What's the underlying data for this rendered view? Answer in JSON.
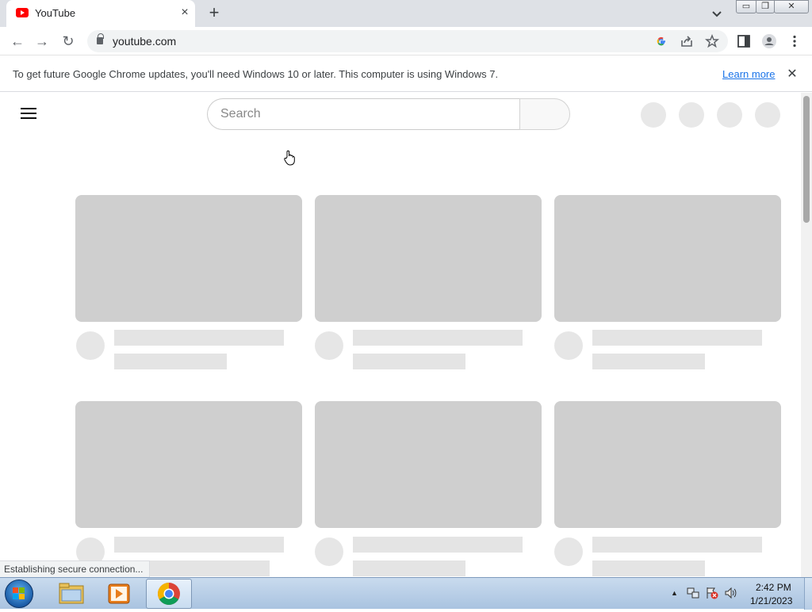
{
  "browser": {
    "tab": {
      "title": "YouTube",
      "close_glyph": "×"
    },
    "new_tab_glyph": "+",
    "window_controls": {
      "minimize": "▭",
      "maximize": "❐",
      "close": "✕"
    },
    "address": {
      "url": "youtube.com"
    },
    "nav": {
      "back": "←",
      "forward": "→",
      "reload": "↻"
    },
    "infobar": {
      "message": "To get future Google Chrome updates, you'll need Windows 10 or later. This computer is using Windows 7.",
      "link": "Learn more",
      "close_glyph": "✕"
    },
    "status_text": "Establishing secure connection..."
  },
  "youtube": {
    "search": {
      "placeholder": "Search"
    }
  },
  "taskbar": {
    "clock": {
      "time": "2:42 PM",
      "date": "1/21/2023"
    },
    "tray_up_glyph": "▲"
  },
  "colors": {
    "accent": "#1a73e8",
    "youtube_red": "#ff0000",
    "skeleton_thumb": "#cfcfcf",
    "skeleton_text": "#e4e4e4"
  },
  "icons": {
    "tab_favicon": "youtube-icon",
    "omnibox": [
      "google-icon",
      "share-icon",
      "star-icon"
    ],
    "toolbar": [
      "side-panel-icon",
      "profile-icon",
      "menu-dots-icon"
    ],
    "taskbar_apps": [
      "explorer-icon",
      "media-player-icon",
      "chrome-icon"
    ],
    "tray": [
      "network-icon",
      "flag-icon",
      "volume-icon"
    ]
  }
}
